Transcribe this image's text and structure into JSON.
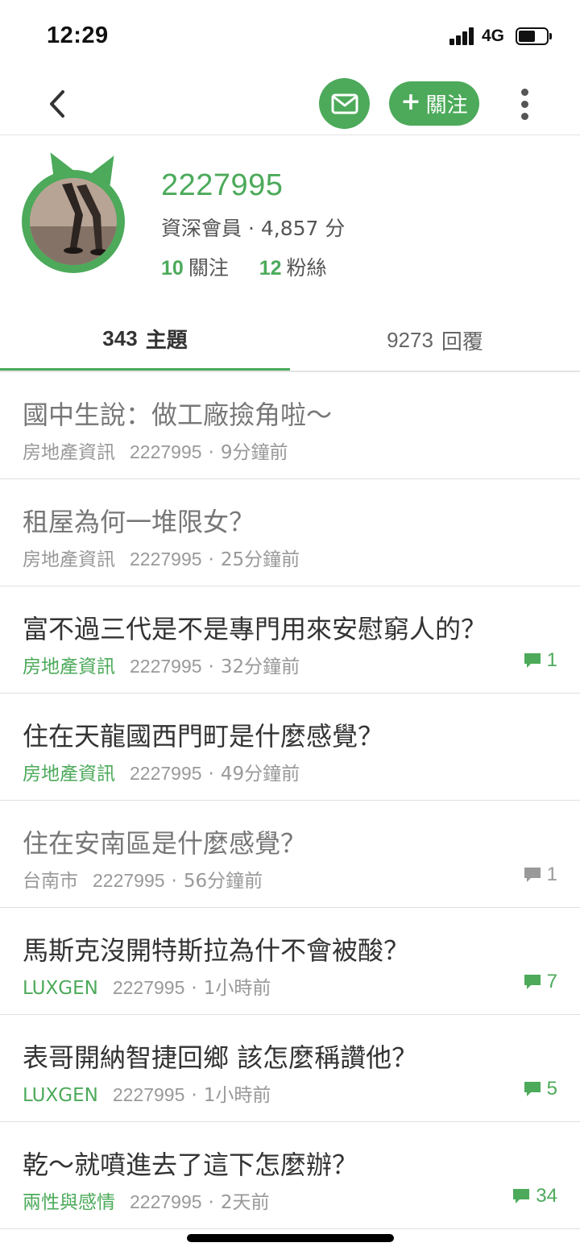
{
  "status_bar": {
    "time": "12:29",
    "network": "4G",
    "battery_level": 0.6
  },
  "nav": {
    "back_icon": "chevron-left-icon",
    "mail_icon": "envelope-icon",
    "follow_plus": "+",
    "follow_label": "關注",
    "more_icon": "vertical-ellipsis-icon"
  },
  "profile": {
    "username": "2227995",
    "member_line": "資深會員 · 4,857 分",
    "following_count": "10",
    "following_label": "關注",
    "followers_count": "12",
    "followers_label": "粉絲"
  },
  "tabs": [
    {
      "count": "343",
      "label": "主題"
    },
    {
      "count": "9273",
      "label": "回覆"
    }
  ],
  "posts": [
    {
      "title": "國中生說：做工廠撿角啦～",
      "category": "房地產資訊",
      "author": "2227995",
      "time": "9分鐘前",
      "comments": ""
    },
    {
      "title": "租屋為何一堆限女？",
      "category": "房地產資訊",
      "author": "2227995",
      "time": "25分鐘前",
      "comments": ""
    },
    {
      "title": "富不過三代是不是專門用來安慰窮人的？",
      "category": "房地產資訊",
      "author": "2227995",
      "time": "32分鐘前",
      "comments": "1"
    },
    {
      "title": "住在天龍國西門町是什麼感覺？",
      "category": "房地產資訊",
      "author": "2227995",
      "time": "49分鐘前",
      "comments": ""
    },
    {
      "title": "住在安南區是什麼感覺？",
      "category": "台南市",
      "author": "2227995",
      "time": "56分鐘前",
      "comments": "1"
    },
    {
      "title": "馬斯克沒開特斯拉為什不會被酸？",
      "category": "LUXGEN",
      "author": "2227995",
      "time": "1小時前",
      "comments": "7"
    },
    {
      "title": "表哥開納智捷回鄉 該怎麼稱讚他？",
      "category": "LUXGEN",
      "author": "2227995",
      "time": "1小時前",
      "comments": "5"
    },
    {
      "title": "乾～就噴進去了這下怎麼辦？",
      "category": "兩性與感情",
      "author": "2227995",
      "time": "2天前",
      "comments": "34"
    }
  ],
  "meta_separator": "·",
  "colors": {
    "accent": "#4caa5a",
    "text": "#333333",
    "muted": "#999999",
    "divider": "#e0e0e0"
  }
}
